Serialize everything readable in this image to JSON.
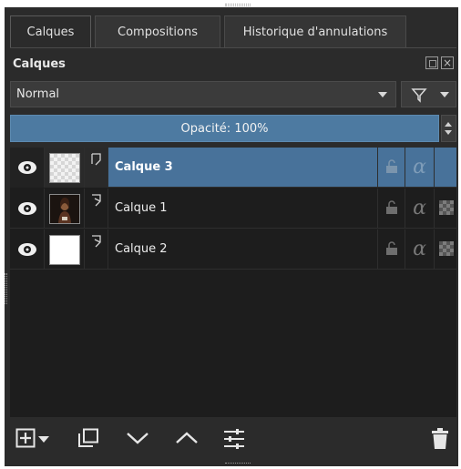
{
  "tabs": [
    {
      "label": "Calques",
      "active": true
    },
    {
      "label": "Compositions",
      "active": false
    },
    {
      "label": "Historique d'annulations",
      "active": false
    }
  ],
  "panel": {
    "title": "Calques",
    "float_icon": "float-icon",
    "close_icon": "close-icon"
  },
  "blend_mode": {
    "value": "Normal",
    "icon": "chevron-down-icon"
  },
  "filter": {
    "icon": "funnel-icon"
  },
  "opacity": {
    "label": "Opacité:  100%",
    "value": 100
  },
  "layers": [
    {
      "name": "Calque 3",
      "selected": true,
      "visible": true,
      "thumbnail": "transparent",
      "type_icon": "paint-layer-icon"
    },
    {
      "name": "Calque 1",
      "selected": false,
      "visible": true,
      "thumbnail": "photo",
      "type_icon": "paint-layer-icon"
    },
    {
      "name": "Calque 2",
      "selected": false,
      "visible": true,
      "thumbnail": "white",
      "type_icon": "paint-layer-icon"
    }
  ],
  "toolbar": {
    "buttons": [
      "add-layer-icon",
      "duplicate-layer-icon",
      "move-down-icon",
      "move-up-icon",
      "layer-properties-icon",
      "delete-layer-icon"
    ]
  },
  "colors": {
    "panel_bg": "#2b2b2b",
    "list_bg": "#1d1d1d",
    "accent": "#4d7aa1",
    "selected_row": "#48729a"
  }
}
